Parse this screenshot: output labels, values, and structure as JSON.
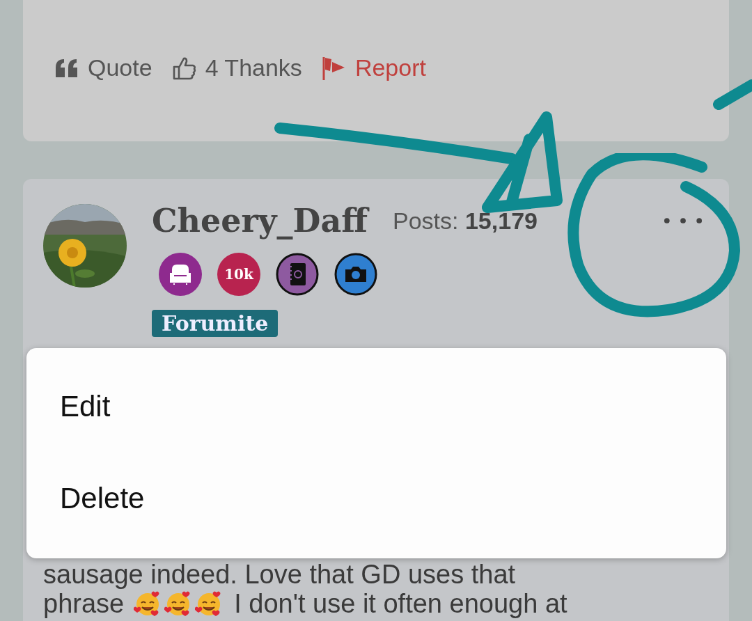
{
  "previous_post": {
    "actions": [
      {
        "kind": "quote",
        "label": "Quote"
      },
      {
        "kind": "thanks",
        "label": "4 Thanks"
      },
      {
        "kind": "report",
        "label": "Report"
      }
    ]
  },
  "post": {
    "author": "Cheery_Daff",
    "posts_label": "Posts:",
    "posts_count": "15,179",
    "badges": [
      {
        "kind": "armchair",
        "color": "#8e2a8e"
      },
      {
        "kind": "count",
        "label": "10k",
        "color": "#b8234f"
      },
      {
        "kind": "address-book",
        "color": "#8e5aa0"
      },
      {
        "kind": "camera",
        "color": "#2f7fd0"
      }
    ],
    "rank": "Forumite",
    "body": [
      {
        "text": "sausage indeed. Love that GD uses that"
      },
      {
        "text": "phrase",
        "emoji": [
          {
            "kind": "smiling-face-hearts"
          },
          {
            "kind": "smiling-face-hearts"
          },
          {
            "kind": "smiling-face-hearts"
          }
        ],
        "after": "I don't use it often enough at"
      }
    ]
  },
  "menu": {
    "items": [
      {
        "label": "Edit"
      },
      {
        "label": "Delete"
      }
    ]
  }
}
